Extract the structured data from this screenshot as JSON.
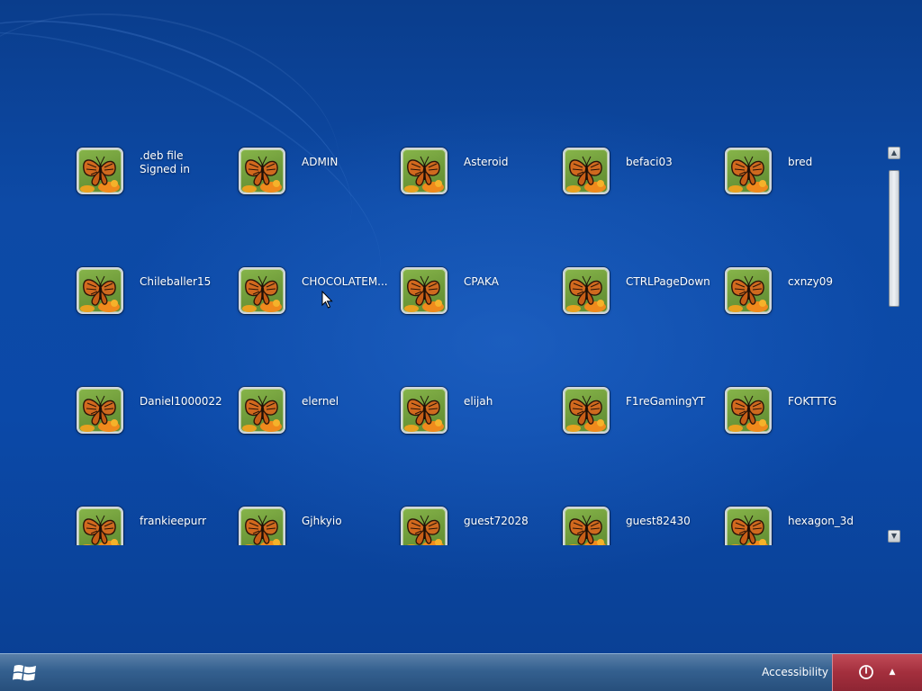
{
  "users": [
    {
      "name": ".deb file",
      "status": "Signed in"
    },
    {
      "name": "ADMIN"
    },
    {
      "name": "Asteroid"
    },
    {
      "name": "befaci03"
    },
    {
      "name": "bred"
    },
    {
      "name": "Chileballer15"
    },
    {
      "name": "CHOCOLATEM..."
    },
    {
      "name": "CPAKA"
    },
    {
      "name": "CTRLPageDown"
    },
    {
      "name": "cxnzy09"
    },
    {
      "name": "Daniel1000022"
    },
    {
      "name": "elernel"
    },
    {
      "name": "elijah"
    },
    {
      "name": "F1reGamingYT"
    },
    {
      "name": "FOKTTTG"
    },
    {
      "name": "frankieepurr"
    },
    {
      "name": "Gjhkyio"
    },
    {
      "name": "guest72028"
    },
    {
      "name": "guest82430"
    },
    {
      "name": "hexagon_3d"
    }
  ],
  "bottom_bar": {
    "accessibility_label": "Accessibility",
    "power_menu_arrow": "▲",
    "windows_logo_icon": "windows-logo-icon",
    "power_icon": "power-icon"
  },
  "scrollbar": {
    "up_arrow": "▲",
    "down_arrow": "▼"
  },
  "colors": {
    "background": "#0b49a8",
    "bottom_bar": "#34608f",
    "power_area": "#a32f3d",
    "avatar_background": "#7aa940"
  }
}
